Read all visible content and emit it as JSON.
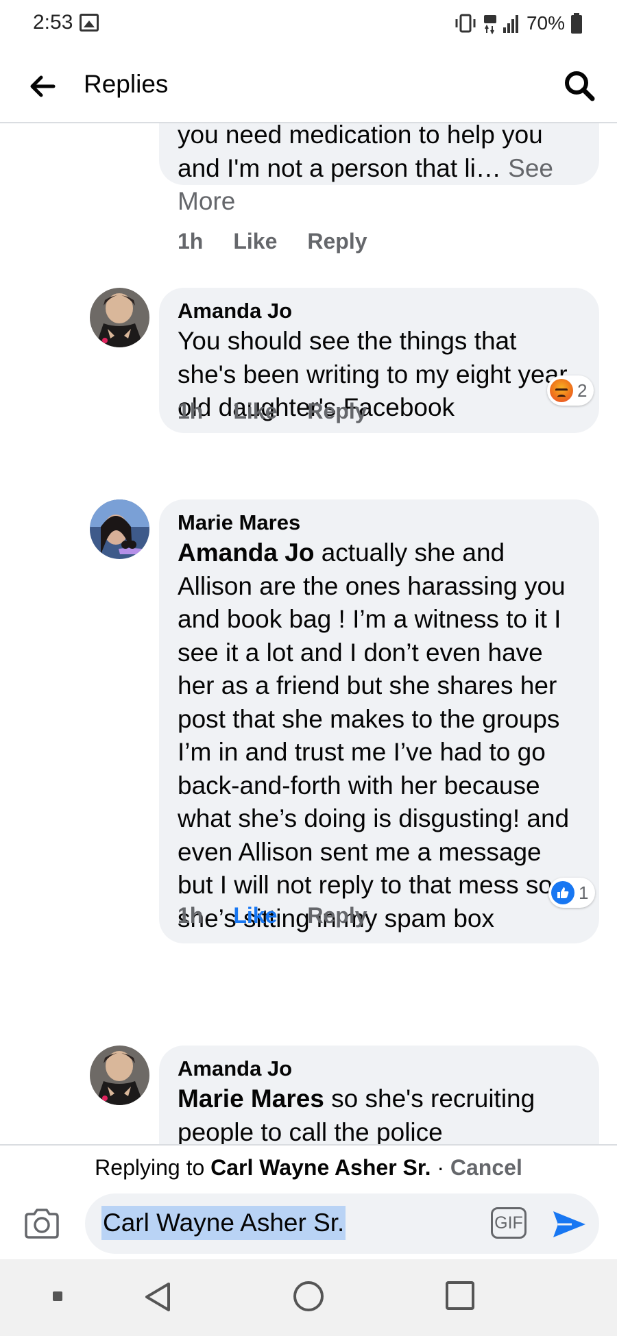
{
  "status_bar": {
    "time": "2:53",
    "battery": "70%"
  },
  "header": {
    "title": "Replies"
  },
  "comments": [
    {
      "text_before": "you need medication to help you and I'm not a person that li…",
      "see_more": " See More",
      "time": "1h",
      "like": "Like",
      "reply": "Reply"
    },
    {
      "author": "Amanda Jo",
      "text": "You should see the things that she's been writing to my eight year old daughter's Facebook",
      "time": "1h",
      "like": "Like",
      "reply": "Reply",
      "reaction": {
        "type": "angry",
        "count": "2"
      }
    },
    {
      "author": "Marie Mares",
      "mention": "Amanda Jo",
      "text": " actually she and Allison are the ones harassing you and book bag ! I’m a witness to it I see it a lot and I don’t even have her as a friend but she shares her post that she makes to the groups I’m in and trust me I’ve had to go back-and-forth with her because what she’s doing is disgusting! and even Allison sent me a message but I will not reply to that mess so she’s sitting in my spam box",
      "time": "1h",
      "like": "Like",
      "liked": true,
      "reply": "Reply",
      "reaction": {
        "type": "like",
        "count": "1"
      }
    },
    {
      "author": "Amanda Jo",
      "mention": "Marie Mares",
      "text": " so she's recruiting people to call the police"
    }
  ],
  "reply_bar": {
    "replying_prefix": "Replying to ",
    "replying_name": "Carl Wayne Asher Sr.",
    "separator": " · ",
    "cancel": "Cancel",
    "input_value": "Carl Wayne Asher Sr.",
    "gif_label": "GIF"
  },
  "colors": {
    "accent": "#1877f2",
    "bubble_bg": "#f0f2f5",
    "secondary_text": "#65676b"
  }
}
